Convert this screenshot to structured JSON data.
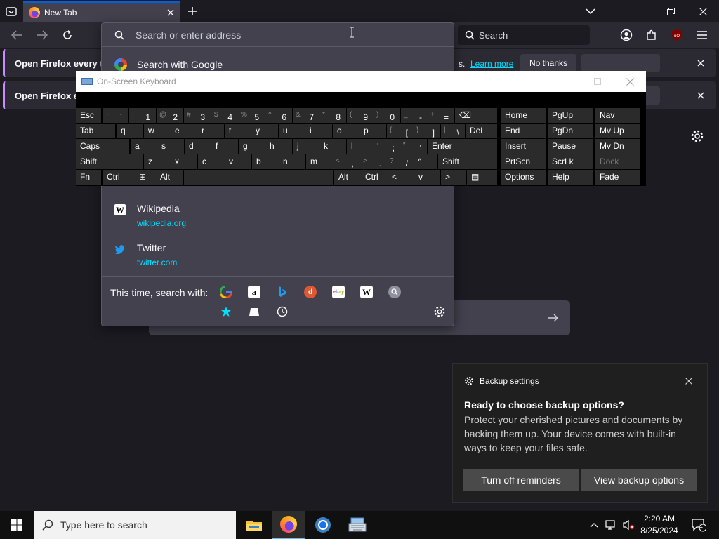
{
  "browser": {
    "tab_title": "New Tab",
    "search_placeholder": "Search",
    "colors": {
      "accent": "#0060df",
      "link": "#00ddff",
      "notif_border": "#c98cfc"
    }
  },
  "notifications": [
    {
      "text": "Open Firefox every ti",
      "tail": "s.",
      "learn_more": "Learn more",
      "no_thanks": "No thanks"
    },
    {
      "text": "Open Firefox ev"
    }
  ],
  "url_dropdown": {
    "input_placeholder": "Search or enter address",
    "google_row": "Search with Google",
    "sites": [
      {
        "title": "Wikipedia",
        "url": "wikipedia.org",
        "icon": "wikipedia-icon"
      },
      {
        "title": "Twitter",
        "url": "twitter.com",
        "icon": "twitter-icon"
      }
    ],
    "search_with_label": "This time, search with:",
    "engines": [
      "google-icon",
      "amazon-icon",
      "bing-icon",
      "duckduckgo-icon",
      "ebay-icon",
      "wikipedia-icon",
      "search-icon",
      "bookmarks-icon",
      "tabs-icon",
      "history-icon"
    ]
  },
  "osk": {
    "title": "On-Screen Keyboard",
    "rows": [
      [
        {
          "p": "Esc"
        },
        {
          "s": "~",
          "m": "`"
        },
        {
          "s": "!",
          "m": "1"
        },
        {
          "s": "@",
          "m": "2"
        },
        {
          "s": "#",
          "m": "3"
        },
        {
          "s": "$",
          "m": "4"
        },
        {
          "s": "%",
          "m": "5"
        },
        {
          "s": "^",
          "m": "6"
        },
        {
          "s": "&",
          "m": "7"
        },
        {
          "s": "*",
          "m": "8"
        },
        {
          "s": "(",
          "m": "9"
        },
        {
          "s": ")",
          "m": "0"
        },
        {
          "s": "_",
          "m": "-"
        },
        {
          "s": "+",
          "m": "="
        },
        {
          "p": "⌫"
        },
        {
          "p": "Home"
        },
        {
          "p": "PgUp"
        },
        {
          "p": "Nav"
        }
      ],
      [
        {
          "p": "Tab"
        },
        {
          "p": "q"
        },
        {
          "p": "w"
        },
        {
          "p": "e"
        },
        {
          "p": "r"
        },
        {
          "p": "t"
        },
        {
          "p": "y"
        },
        {
          "p": "u"
        },
        {
          "p": "i"
        },
        {
          "p": "o"
        },
        {
          "p": "p"
        },
        {
          "s": "{",
          "m": "["
        },
        {
          "s": "}",
          "m": "]"
        },
        {
          "s": "|",
          "m": "\\"
        },
        {
          "p": "Del"
        },
        {
          "p": "End"
        },
        {
          "p": "PgDn"
        },
        {
          "p": "Mv Up"
        }
      ],
      [
        {
          "p": "Caps"
        },
        {
          "p": "a"
        },
        {
          "p": "s"
        },
        {
          "p": "d"
        },
        {
          "p": "f"
        },
        {
          "p": "g"
        },
        {
          "p": "h"
        },
        {
          "p": "j"
        },
        {
          "p": "k"
        },
        {
          "p": "l"
        },
        {
          "s": ":",
          "m": ";"
        },
        {
          "s": "\"",
          "m": "'"
        },
        {
          "p": "Enter"
        },
        {
          "p": "Insert"
        },
        {
          "p": "Pause"
        },
        {
          "p": "Mv Dn"
        }
      ],
      [
        {
          "p": "Shift"
        },
        {
          "p": "z"
        },
        {
          "p": "x"
        },
        {
          "p": "c"
        },
        {
          "p": "v"
        },
        {
          "p": "b"
        },
        {
          "p": "n"
        },
        {
          "p": "m"
        },
        {
          "s": "<",
          "m": ","
        },
        {
          "s": ">",
          "m": "."
        },
        {
          "s": "?",
          "m": "/"
        },
        {
          "p": "^"
        },
        {
          "p": "Shift"
        },
        {
          "p": "PrtScn"
        },
        {
          "p": "ScrLk"
        },
        {
          "p": "Dock"
        }
      ],
      [
        {
          "p": "Fn"
        },
        {
          "p": "Ctrl"
        },
        {
          "p": "⊞"
        },
        {
          "p": "Alt"
        },
        {
          "p": ""
        },
        {
          "p": "Alt"
        },
        {
          "p": "Ctrl"
        },
        {
          "p": "<"
        },
        {
          "p": "v"
        },
        {
          "p": ">"
        },
        {
          "p": "▤"
        },
        {
          "p": "Options"
        },
        {
          "p": "Help"
        },
        {
          "p": "Fade"
        }
      ]
    ]
  },
  "toast": {
    "header": "Backup settings",
    "heading": "Ready to choose backup options?",
    "body": "Protect your cherished pictures and documents by backing them up. Your device comes with built-in ways to keep your files safe.",
    "btn_off": "Turn off reminders",
    "btn_view": "View backup options"
  },
  "taskbar": {
    "search_placeholder": "Type here to search",
    "time": "2:20 AM",
    "date": "8/25/2024",
    "notif_count": "1"
  }
}
